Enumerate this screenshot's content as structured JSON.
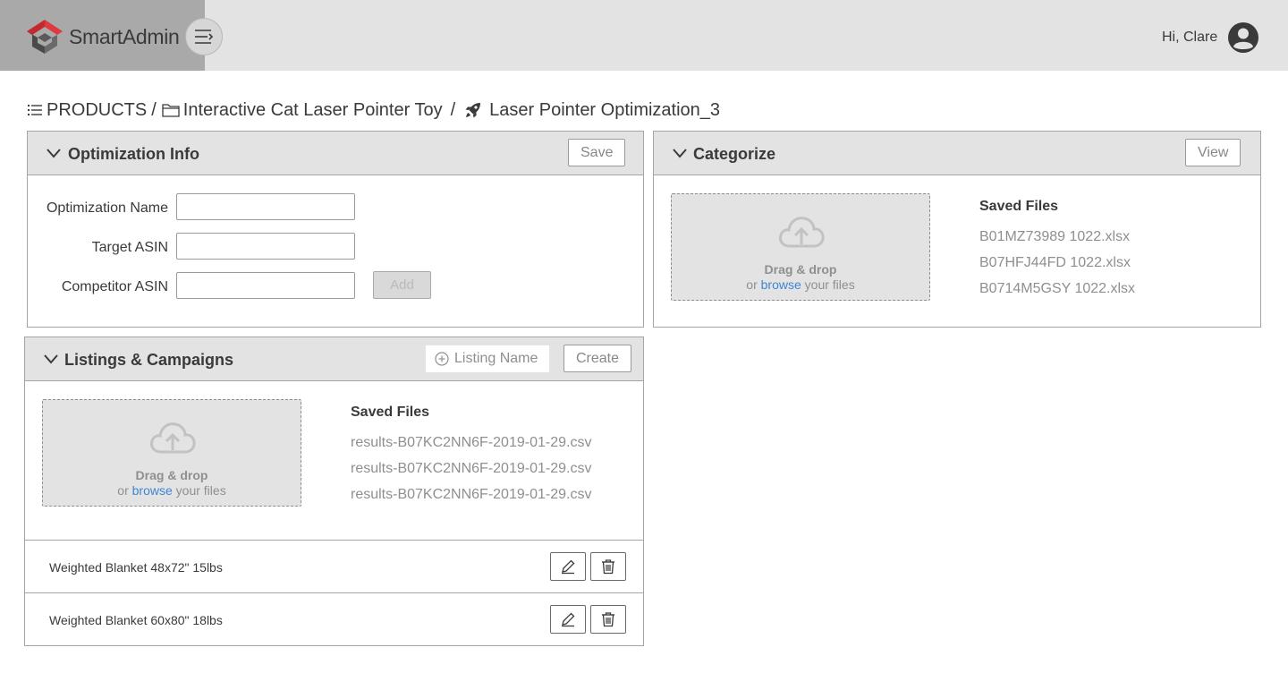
{
  "header": {
    "brand": "SmartAdmin",
    "greeting": "Hi, Clare"
  },
  "breadcrumb": {
    "root": "PRODUCTS",
    "product": "Interactive Cat Laser Pointer Toy",
    "optimization": "Laser Pointer Optimization_3"
  },
  "optimization_info": {
    "title": "Optimization Info",
    "save_label": "Save",
    "fields": {
      "name_label": "Optimization Name",
      "name_value": "",
      "target_label": "Target ASIN",
      "target_value": "",
      "competitor_label": "Competitor ASIN",
      "competitor_value": ""
    },
    "add_label": "Add"
  },
  "categorize": {
    "title": "Categorize",
    "view_label": "View",
    "dropzone": {
      "title": "Drag & drop",
      "prefix": "or",
      "link": "browse",
      "suffix": "your files"
    },
    "saved_title": "Saved Files",
    "files": [
      "B01MZ73989 1022.xlsx",
      "B07HFJ44FD 1022.xlsx",
      "B0714M5GSY 1022.xlsx"
    ]
  },
  "listings": {
    "title": "Listings & Campaigns",
    "listing_placeholder": "Listing Name",
    "create_label": "Create",
    "dropzone": {
      "title": "Drag & drop",
      "prefix": "or",
      "link": "browse",
      "suffix": "your files"
    },
    "saved_title": "Saved Files",
    "files": [
      "results-B07KC2NN6F-2019-01-29.csv",
      "results-B07KC2NN6F-2019-01-29.csv",
      "results-B07KC2NN6F-2019-01-29.csv"
    ],
    "rows": [
      {
        "name": "Weighted Blanket 48x72\" 15lbs"
      },
      {
        "name": "Weighted Blanket 60x80\" 18lbs"
      }
    ]
  },
  "colors": {
    "header_bg": "#e3e3e3",
    "brand_bg": "#a9a9a9",
    "logo_red": "#e0393e",
    "logo_dark": "#4a4a4a",
    "link": "#3d86d4"
  },
  "icons": [
    "hamburger-menu-icon",
    "user-avatar-icon",
    "list-icon",
    "folder-icon",
    "rocket-icon",
    "chevron-down-icon",
    "cloud-upload-icon",
    "plus-circle-icon",
    "pencil-icon",
    "trash-icon"
  ]
}
